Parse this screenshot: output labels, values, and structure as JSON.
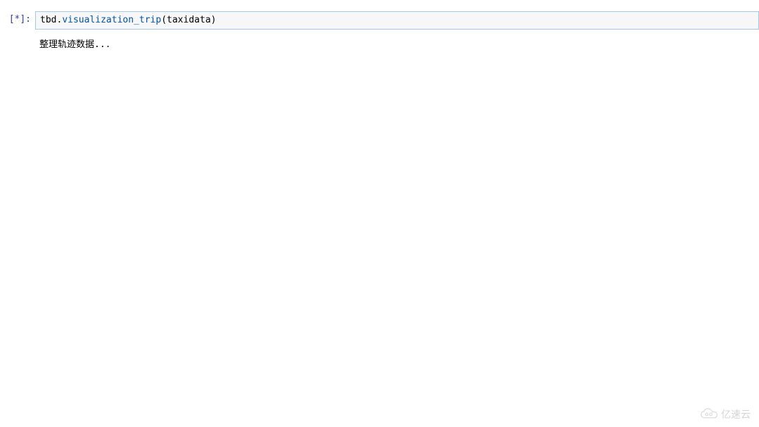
{
  "cell": {
    "prompt_open": "[",
    "prompt_exec": "*",
    "prompt_close": "]:",
    "code": {
      "obj": "tbd.",
      "func": "visualization_trip",
      "paren_open": "(",
      "arg": "taxidata",
      "paren_close": ")"
    }
  },
  "output": {
    "text": "整理轨迹数据..."
  },
  "watermark": {
    "text": "亿速云"
  }
}
